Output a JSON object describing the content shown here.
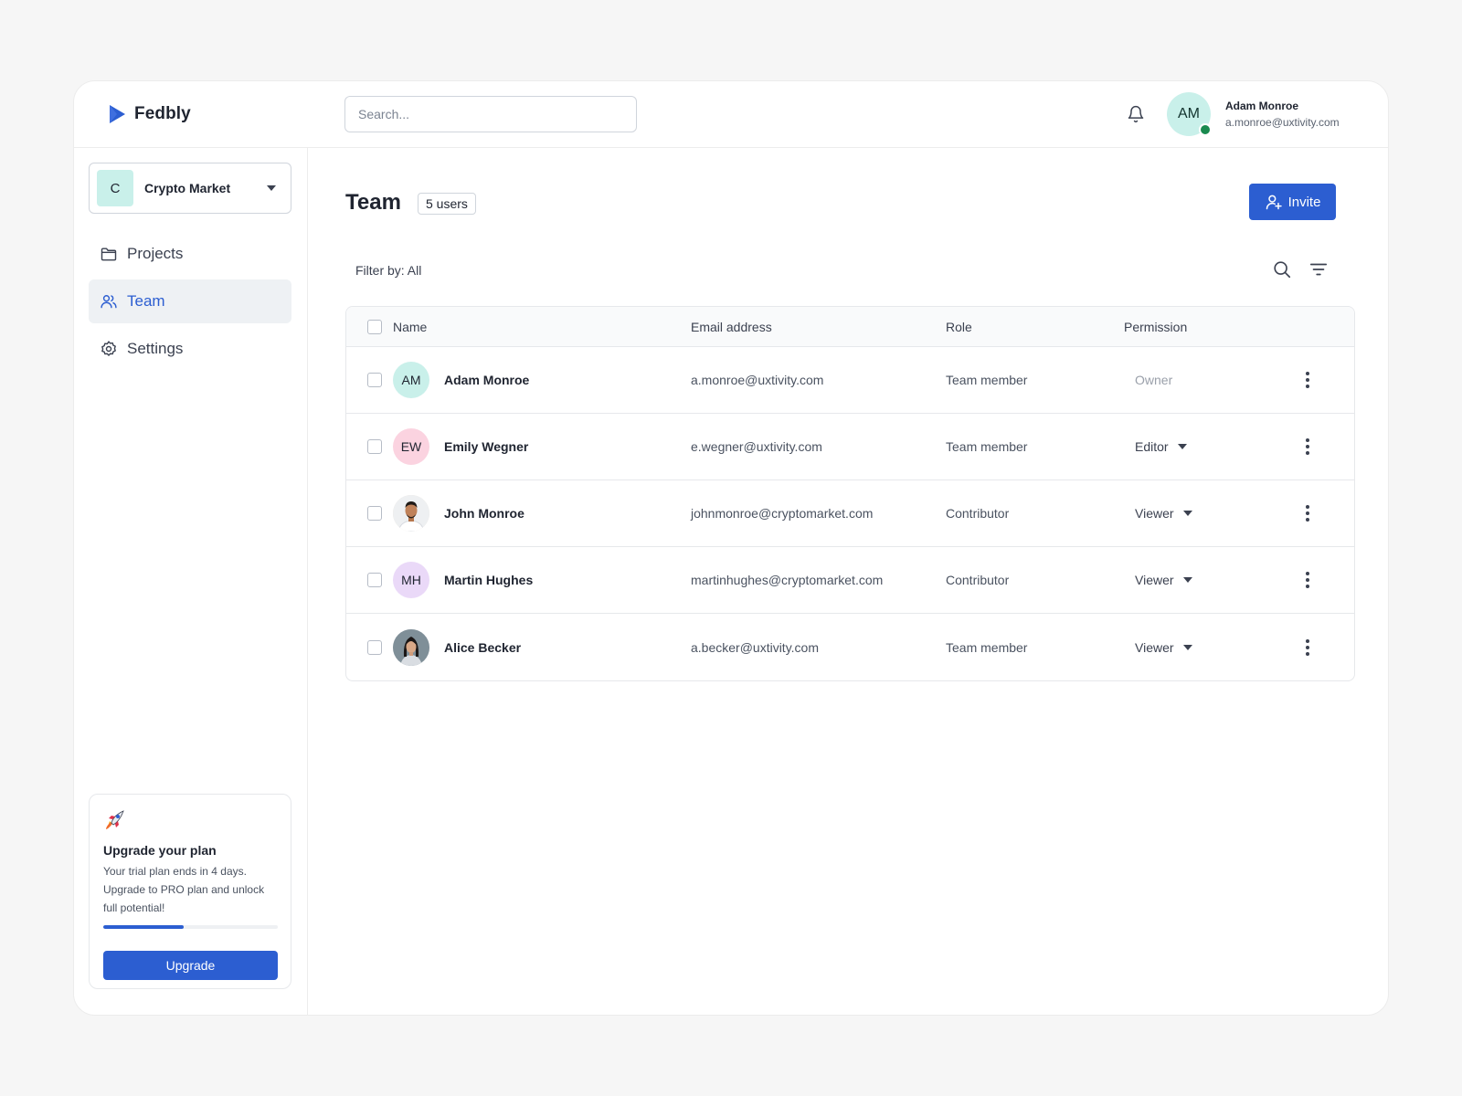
{
  "brand": {
    "name": "Fedbly",
    "accent": "#2c5ed1"
  },
  "header": {
    "search_placeholder": "Search...",
    "user": {
      "initials": "AM",
      "name": "Adam Monroe",
      "email": "a.monroe@uxtivity.com",
      "status_color": "#1a8a4f"
    }
  },
  "sidebar": {
    "workspace": {
      "badge": "C",
      "name": "Crypto Market"
    },
    "items": [
      {
        "label": "Projects",
        "icon": "folder-icon",
        "active": false
      },
      {
        "label": "Team",
        "icon": "users-icon",
        "active": true
      },
      {
        "label": "Settings",
        "icon": "gear-icon",
        "active": false
      }
    ],
    "upgrade": {
      "title": "Upgrade your plan",
      "text": "Your trial plan ends in 4 days. Upgrade to PRO plan and unlock full potential!",
      "progress": 0.46,
      "button_label": "Upgrade"
    }
  },
  "main": {
    "title": "Team",
    "count_badge": "5 users",
    "invite_label": "Invite",
    "filter_label": "Filter by: All",
    "table": {
      "headers": {
        "name": "Name",
        "email": "Email address",
        "role": "Role",
        "permission": "Permission"
      },
      "rows": [
        {
          "initials": "AM",
          "avatar_color": "#c9f0ea",
          "photo": false,
          "name": "Adam Monroe",
          "email": "a.monroe@uxtivity.com",
          "role": "Team member",
          "permission": "Owner",
          "editable": false
        },
        {
          "initials": "EW",
          "avatar_color": "#fbd3e0",
          "photo": false,
          "name": "Emily Wegner",
          "email": "e.wegner@uxtivity.com",
          "role": "Team member",
          "permission": "Editor",
          "editable": true
        },
        {
          "initials": "",
          "avatar_color": "#e8dccf",
          "photo": true,
          "name": "John Monroe",
          "email": "johnmonroe@cryptomarket.com",
          "role": "Contributor",
          "permission": "Viewer",
          "editable": true
        },
        {
          "initials": "MH",
          "avatar_color": "#ead9f8",
          "photo": false,
          "name": "Martin Hughes",
          "email": "martinhughes@cryptomarket.com",
          "role": "Contributor",
          "permission": "Viewer",
          "editable": true
        },
        {
          "initials": "",
          "avatar_color": "#c5ccd2",
          "photo": true,
          "name": "Alice Becker",
          "email": "a.becker@uxtivity.com",
          "role": "Team member",
          "permission": "Viewer",
          "editable": true
        }
      ]
    }
  }
}
